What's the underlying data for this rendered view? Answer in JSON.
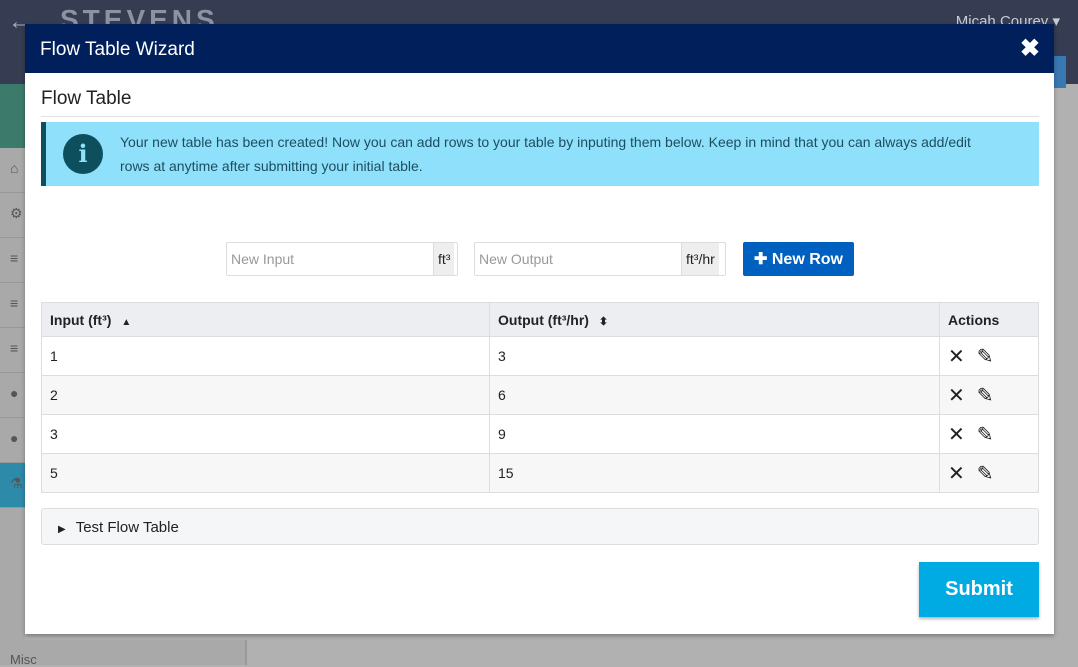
{
  "app": {
    "logo": "STEVENS",
    "user": "Micah Courey ▾",
    "misc": "Misc"
  },
  "modal": {
    "title": "Flow Table Wizard",
    "section_title": "Flow Table",
    "info": "Your new table has been created! Now you can add rows to your table by inputing them below. Keep in mind that you can always add/edit rows at anytime after submitting your initial table.",
    "input_placeholder": "New Input",
    "input_unit": "ft³",
    "output_placeholder": "New Output",
    "output_unit": "ft³/hr",
    "new_row": "New Row",
    "columns": [
      "Input (ft³)",
      "Output (ft³/hr)",
      "Actions"
    ],
    "rows": [
      {
        "input": "1",
        "output": "3"
      },
      {
        "input": "2",
        "output": "6"
      },
      {
        "input": "3",
        "output": "9"
      },
      {
        "input": "5",
        "output": "15"
      }
    ],
    "accordion": "Test Flow Table",
    "submit": "Submit"
  }
}
